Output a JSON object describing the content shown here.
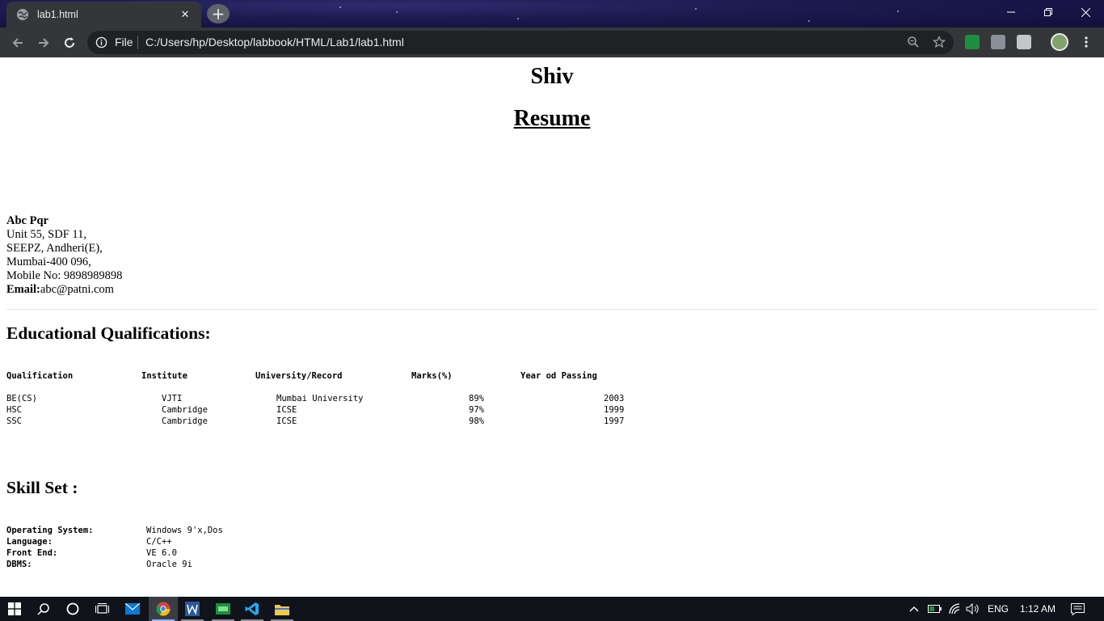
{
  "browser": {
    "tab": {
      "title": "lab1.html",
      "close_glyph": "✕",
      "favicon": "globe-icon"
    },
    "new_tab_glyph": "+",
    "omnibox": {
      "scheme_label": "File",
      "url": "C:/Users/hp/Desktop/labbook/HTML/Lab1/lab1.html"
    }
  },
  "page": {
    "name": "Shiv",
    "title": "Resume",
    "contact": {
      "name": "Abc Pqr",
      "address_line1": "Unit 55, SDF 11,",
      "address_line2": "SEEPZ, Andheri(E),",
      "address_line3": "Mumbai-400 096,",
      "mobile": "Mobile No: 9898989898",
      "email_label": "Email:",
      "email": "abc@patni.com"
    },
    "education": {
      "heading": "Educational Qualifications:",
      "columns": [
        "Qualification",
        "Institute",
        "University/Record",
        "Marks(%)",
        "Year od Passing"
      ],
      "rows": [
        [
          "BE(CS)",
          "VJTI",
          "Mumbai University",
          "89%",
          "2003"
        ],
        [
          "HSC",
          "Cambridge",
          "ICSE",
          "97%",
          "1999"
        ],
        [
          "SSC",
          "Cambridge",
          "ICSE",
          "98%",
          "1997"
        ]
      ]
    },
    "skills": {
      "heading": "Skill Set :",
      "items": [
        {
          "label": "Operating System:",
          "value": "Windows 9'x,Dos"
        },
        {
          "label": "Language:",
          "value": "C/C++"
        },
        {
          "label": "Front End:",
          "value": "VE 6.0"
        },
        {
          "label": "DBMS:",
          "value": "Oracle 9i"
        }
      ]
    }
  },
  "taskbar": {
    "language": "ENG",
    "time": "1:12 AM"
  },
  "colors": {
    "tab_bg": "#35363a",
    "omnibox_bg": "#202124",
    "taskbar_bg": "#101319"
  }
}
